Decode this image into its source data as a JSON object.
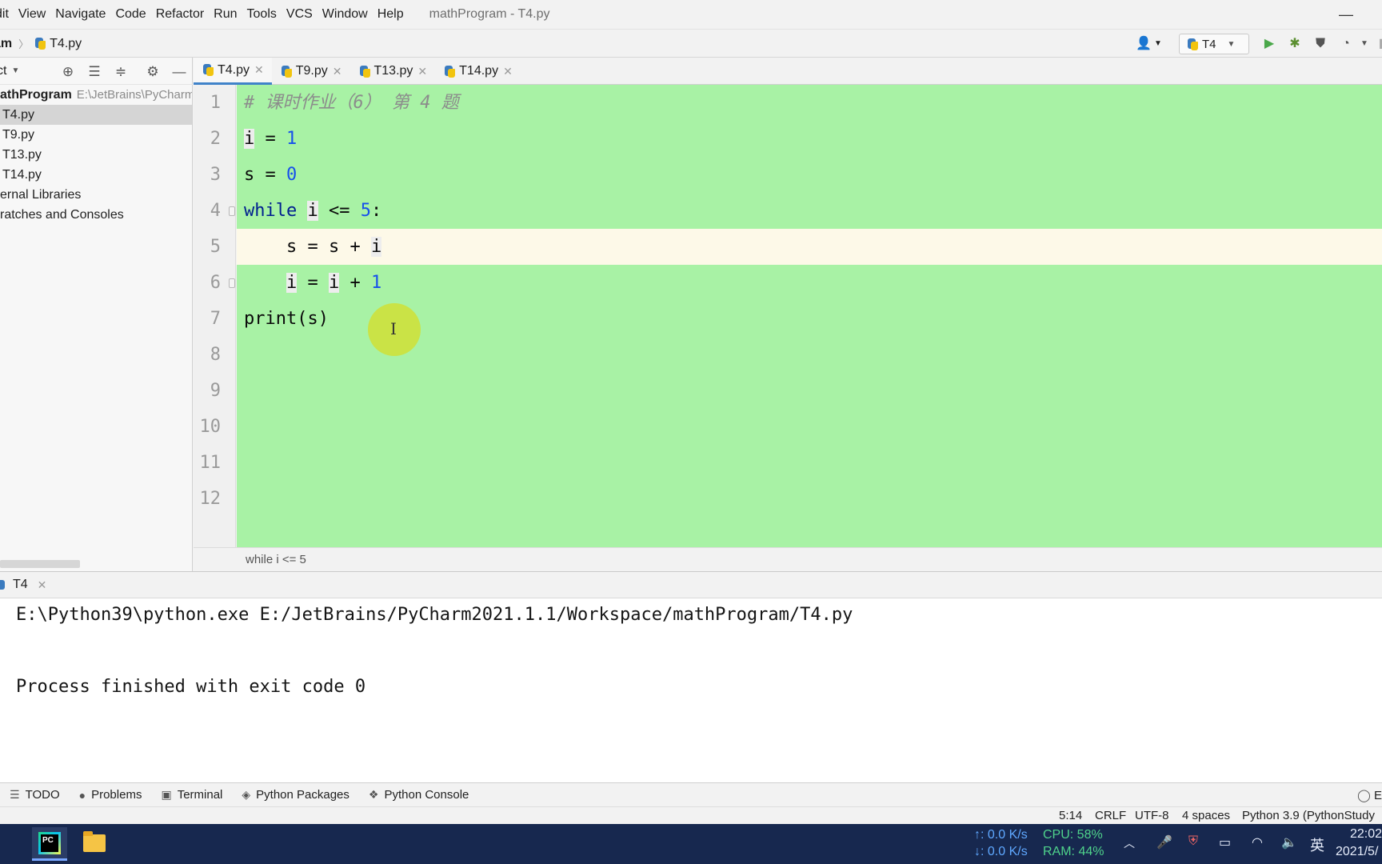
{
  "menu": {
    "items": [
      "dit",
      "View",
      "Navigate",
      "Code",
      "Refactor",
      "Run",
      "Tools",
      "VCS",
      "Window",
      "Help"
    ],
    "window_title": "mathProgram - T4.py"
  },
  "navbar": {
    "project": "am",
    "file": "T4.py",
    "run_config": "T4"
  },
  "project_panel": {
    "header": "ct",
    "root_name": "athProgram",
    "root_path": "E:\\JetBrains\\PyCharm",
    "files": [
      "T4.py",
      "T9.py",
      "T13.py",
      "T14.py"
    ],
    "external_libraries": "ernal Libraries",
    "scratches": "ratches and Consoles"
  },
  "editor": {
    "tabs": [
      "T4.py",
      "T9.py",
      "T13.py",
      "T14.py"
    ],
    "active_tab": "T4.py",
    "line_numbers": [
      "1",
      "2",
      "3",
      "4",
      "5",
      "6",
      "7",
      "8",
      "9",
      "10",
      "11",
      "12"
    ],
    "code": {
      "comment": "# 课时作业（6） 第 4 题",
      "l2_var": "i",
      "l2_eq": " = ",
      "l2_num": "1",
      "l3_var": "s",
      "l3_eq": " = ",
      "l3_num": "0",
      "l4_kw": "while",
      "l4_var": "i",
      "l4_op": " <= ",
      "l4_num": "5",
      "l4_colon": ":",
      "l5_text": "    s = s + ",
      "l5_var": "i",
      "l6_var1": "i",
      "l6_mid": " = ",
      "l6_var2": "i",
      "l6_op": " + ",
      "l6_num": "1",
      "l7_text": "print(s)"
    },
    "current_line": 5,
    "breadcrumb": "while i <= 5"
  },
  "run_panel": {
    "tab": "T4",
    "output_line1": "E:\\Python39\\python.exe E:/JetBrains/PyCharm2021.1.1/Workspace/mathProgram/T4.py",
    "output_line2": "Process finished with exit code 0"
  },
  "tool_windows": [
    "TODO",
    "Problems",
    "Terminal",
    "Python Packages",
    "Python Console"
  ],
  "tool_windows_right": "E",
  "status_bar": {
    "position": "5:14",
    "line_sep": "CRLF",
    "encoding": "UTF-8",
    "indent": "4 spaces",
    "interpreter": "Python 3.9 (PythonStudy"
  },
  "taskbar": {
    "net_up": "↑: 0.0 K/s",
    "net_down": "↓: 0.0 K/s",
    "cpu": "CPU:  58%",
    "ram": "RAM: 44%",
    "ime": "英",
    "time": "22:02",
    "date": "2021/5/"
  },
  "colors": {
    "editor_bg": "#a8f2a5",
    "current_line_bg": "#fdf9e8",
    "keyword": "#00208f",
    "number": "#1750eb",
    "taskbar_bg": "#17284f"
  }
}
